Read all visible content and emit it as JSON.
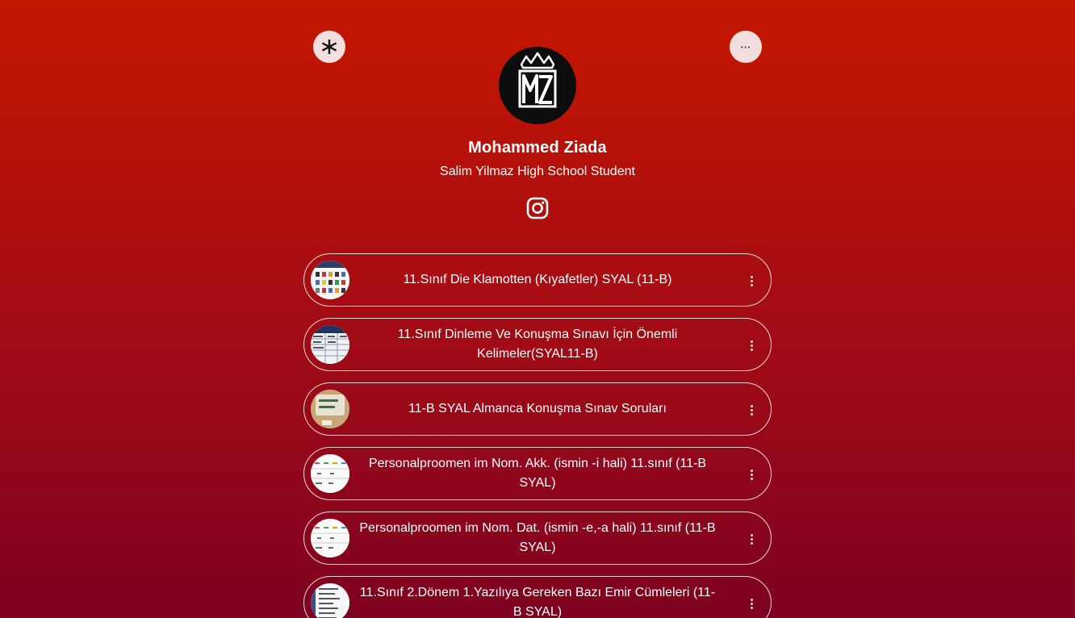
{
  "profile": {
    "name": "Mohammed Ziada",
    "bio": "Salim Yilmaz High School Student",
    "avatar_icon": "mz-crown-logo",
    "social_icon": "instagram-icon"
  },
  "top_buttons": {
    "left_icon": "linktree-asterisk-icon",
    "right_icon": "more-options-icon",
    "right_label": "···"
  },
  "links": [
    {
      "title": "11.Sınıf Die Klamotten (Kıyafetler) SYAL (11-B)",
      "thumb": "clothes-grid"
    },
    {
      "title": "11.Sınıf Dinleme Ve Konuşma Sınavı İçin Önemli Kelimeler(SYAL11-B)",
      "thumb": "word-table"
    },
    {
      "title": "11-B SYAL Almanca Konuşma Sınav Soruları",
      "thumb": "was-klaut-der-hund"
    },
    {
      "title": "Personalproomen im Nom. Akk. (ismin -i hali) 11.sınıf (11-B SYAL)",
      "thumb": "pronoun-table"
    },
    {
      "title": "Personalproomen im Nom. Dat. (ismin -e,-a hali) 11.sınıf (11-B SYAL)",
      "thumb": "pronoun-table"
    },
    {
      "title": "11.Sınıf 2.Dönem 1.Yazılıya Gereken Bazı Emir Cümleleri (11-B SYAL)",
      "thumb": "sentence-list"
    }
  ],
  "colors": {
    "background_top": "#c41700",
    "background_bottom": "#7d0220",
    "button_bg": "#f3dede"
  }
}
